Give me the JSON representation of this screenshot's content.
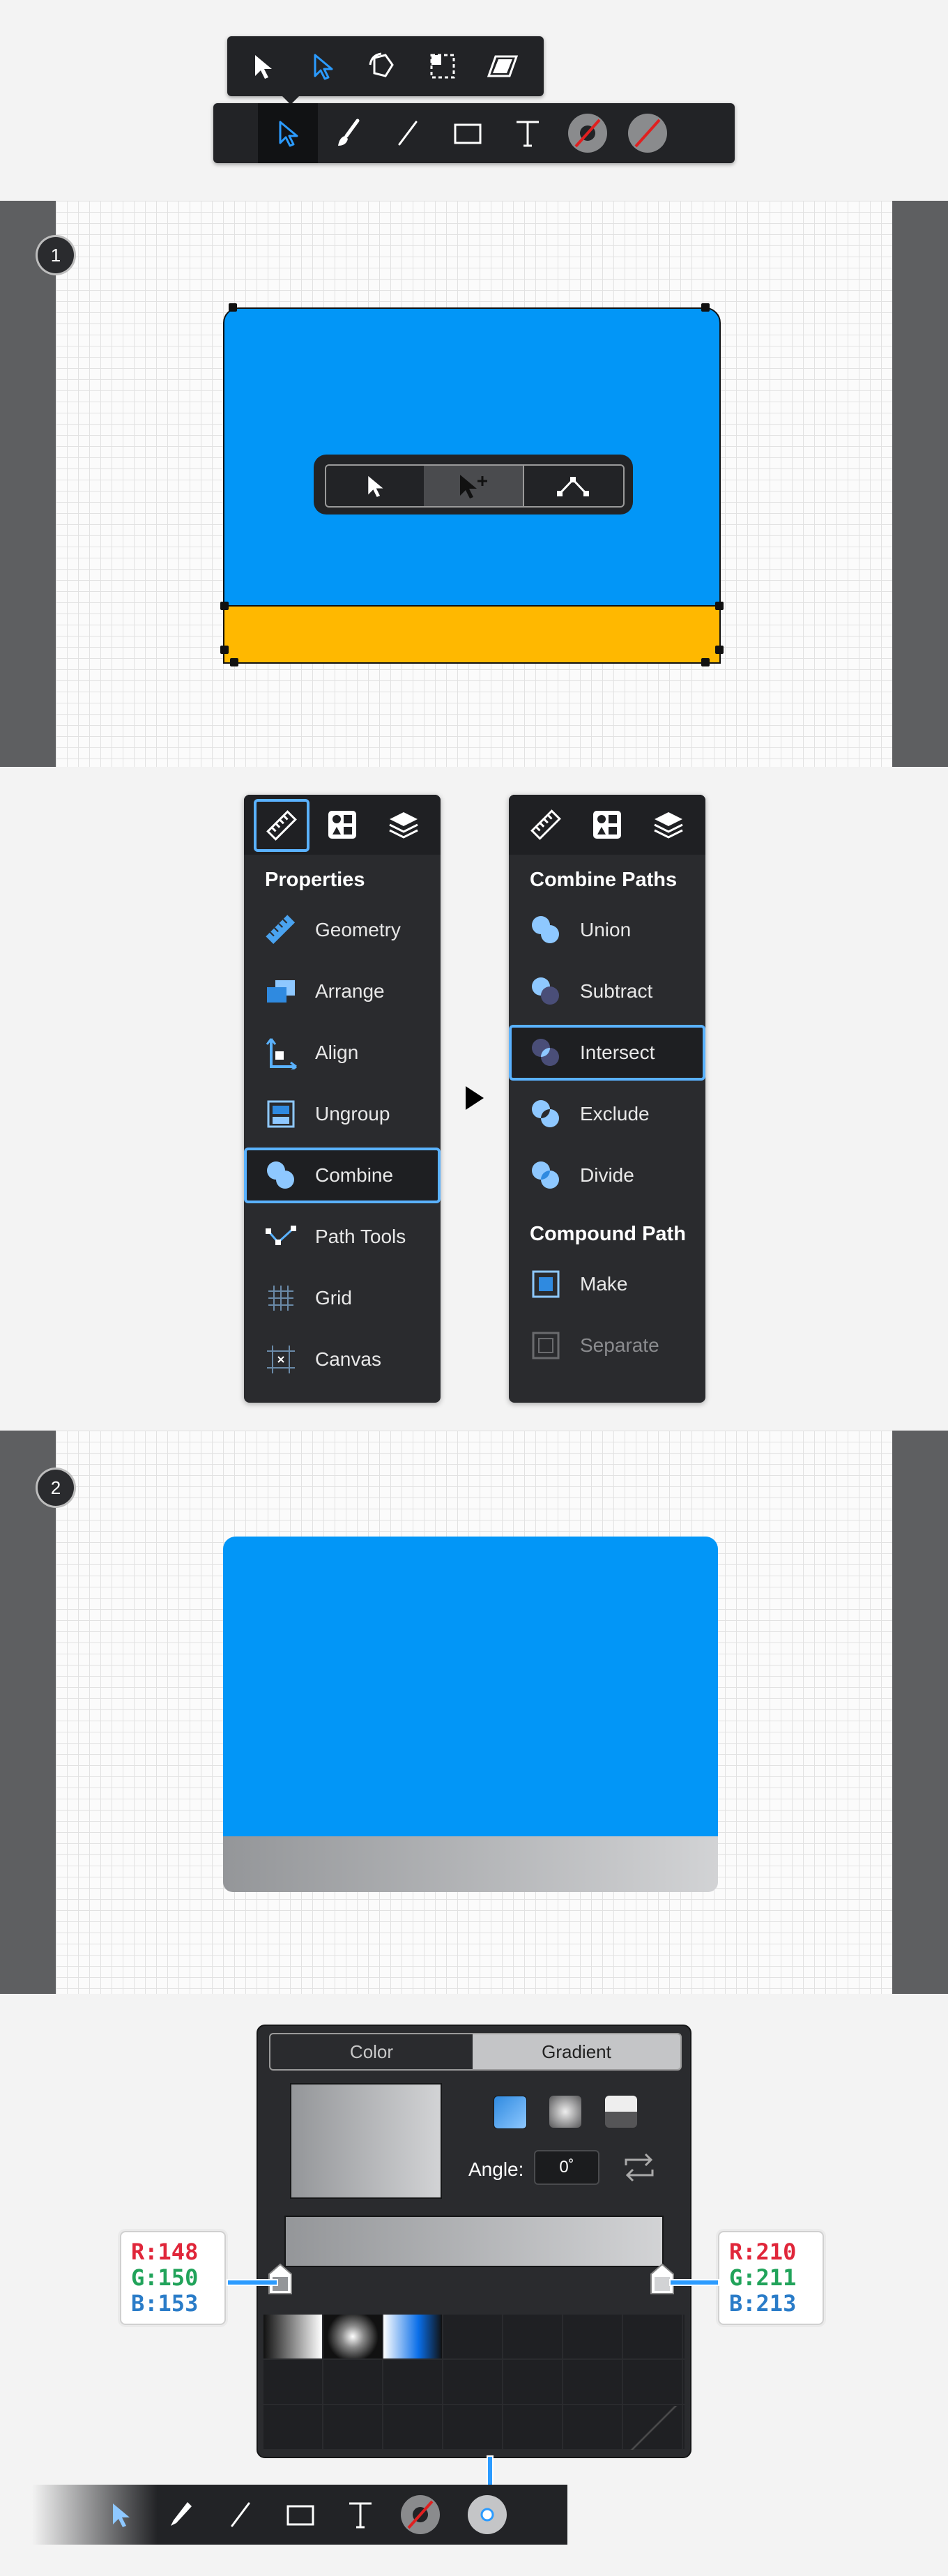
{
  "colors": {
    "blue": "#0296f7",
    "yellow": "#ffb800",
    "selection": "#5ab2ff",
    "dark": "#222326"
  },
  "top_toolbar": {
    "sub_tools": [
      "select-icon",
      "direct-select-icon",
      "transform-icon",
      "marquee-select-icon",
      "skew-icon"
    ],
    "tools": [
      "direct-select-icon",
      "brush-icon",
      "line-icon",
      "rectangle-icon",
      "text-icon",
      "stroke-color-icon",
      "fill-color-icon"
    ]
  },
  "step1": {
    "badge": "1",
    "mode_tools": [
      "select-icon",
      "add-select-icon",
      "path-node-icon"
    ]
  },
  "properties_panel": {
    "title": "Properties",
    "tabs": [
      "ruler-icon",
      "shapes-icon",
      "layers-icon"
    ],
    "items": [
      {
        "label": "Geometry",
        "icon": "ruler-icon"
      },
      {
        "label": "Arrange",
        "icon": "arrange-icon"
      },
      {
        "label": "Align",
        "icon": "align-icon"
      },
      {
        "label": "Ungroup",
        "icon": "ungroup-icon"
      },
      {
        "label": "Combine",
        "icon": "combine-icon"
      },
      {
        "label": "Path Tools",
        "icon": "path-tools-icon"
      },
      {
        "label": "Grid",
        "icon": "grid-icon"
      },
      {
        "label": "Canvas",
        "icon": "canvas-icon"
      }
    ]
  },
  "combine_panel": {
    "title": "Combine Paths",
    "items": [
      {
        "label": "Union"
      },
      {
        "label": "Subtract"
      },
      {
        "label": "Intersect"
      },
      {
        "label": "Exclude"
      },
      {
        "label": "Divide"
      }
    ],
    "compound_title": "Compound Path",
    "compound_items": [
      {
        "label": "Make"
      },
      {
        "label": "Separate"
      }
    ]
  },
  "step2": {
    "badge": "2"
  },
  "color_picker": {
    "tab_color": "Color",
    "tab_gradient": "Gradient",
    "angle_label": "Angle:",
    "angle_value": "0˚",
    "left_stop": {
      "r": "R:148",
      "g": "G:150",
      "b": "B:153"
    },
    "right_stop": {
      "r": "R:210",
      "g": "G:211",
      "b": "B:213"
    }
  },
  "bottom_toolbar": {
    "tools": [
      "direct-select-icon",
      "pen-icon",
      "line-icon",
      "rectangle-icon",
      "text-icon",
      "stroke-color-icon",
      "fill-color-icon"
    ]
  }
}
